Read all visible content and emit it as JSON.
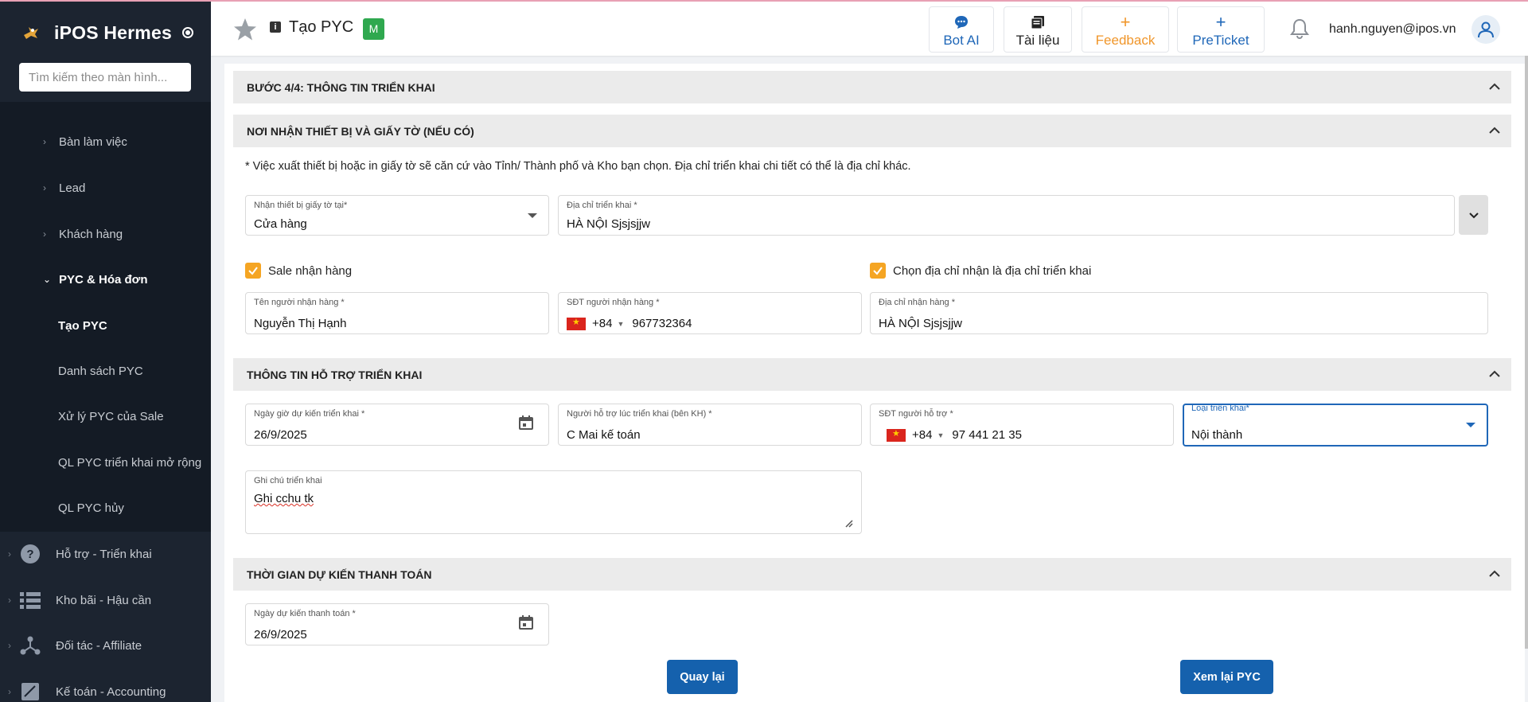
{
  "sidebar": {
    "brand": "iPOS Hermes",
    "search_placeholder": "Tìm kiếm theo màn hình...",
    "sub_items": [
      {
        "label": "Bàn làm việc"
      },
      {
        "label": "Lead"
      },
      {
        "label": "Khách hàng"
      },
      {
        "label": "PYC & Hóa đơn"
      },
      {
        "label": "Tạo PYC"
      },
      {
        "label": "Danh sách PYC"
      },
      {
        "label": "Xử lý PYC của Sale"
      },
      {
        "label": "QL PYC triển khai mở rộng"
      },
      {
        "label": "QL PYC hủy"
      }
    ],
    "main_items": [
      {
        "label": "Hỗ trợ - Triển khai",
        "icon": "help-circle-icon"
      },
      {
        "label": "Kho bãi - Hậu cần",
        "icon": "list-icon"
      },
      {
        "label": "Đối tác - Affiliate",
        "icon": "network-icon"
      },
      {
        "label": "Kế toán - Accounting",
        "icon": "accounting-icon"
      }
    ]
  },
  "header": {
    "title": "Tạo PYC",
    "badge": "M",
    "buttons": [
      {
        "label": "Bot AI",
        "icon": "chat-icon",
        "color": "#1f67b8"
      },
      {
        "label": "Tài liệu",
        "icon": "document-icon",
        "color": "#222222"
      },
      {
        "label": "Feedback",
        "icon": "plus-icon",
        "color": "#f0962a"
      },
      {
        "label": "PreTicket",
        "icon": "plus-icon",
        "color": "#1f67b8"
      }
    ],
    "user_email": "hanh.nguyen@ipos.vn"
  },
  "sections": {
    "step": "BƯỚC 4/4: THÔNG TIN TRIỂN KHAI",
    "receive": "NƠI NHẬN THIẾT BỊ VÀ GIẤY TỜ (NẾU CÓ)",
    "support": "THÔNG TIN HỖ TRỢ TRIỂN KHAI",
    "payment": "THỜI GIAN DỰ KIẾN THANH TOÁN"
  },
  "note": "* Việc xuất thiết bị hoặc in giấy tờ sẽ căn cứ vào Tỉnh/ Thành phố và Kho bạn chọn. Địa chỉ triển khai chi tiết có thể là địa chỉ khác.",
  "form": {
    "receive_at": {
      "label": "Nhận thiết bị giấy tờ tại*",
      "value": "Cửa hàng"
    },
    "deploy_address": {
      "label": "Địa chỉ triển khai *",
      "value": "HÀ NỘI Sjsjsjjw"
    },
    "sale_receive": {
      "label": "Sale nhận hàng",
      "checked": true
    },
    "use_deploy_address": {
      "label": "Chọn địa chỉ nhận là địa chỉ triển khai",
      "checked": true
    },
    "receiver_name": {
      "label": "Tên người nhận hàng *",
      "value": "Nguyễn Thị Hạnh"
    },
    "receiver_phone": {
      "label": "SĐT người nhận hàng *",
      "code": "+84",
      "value": "967732364"
    },
    "receiver_address": {
      "label": "Địa chỉ nhận hàng *",
      "value": "HÀ NỘI Sjsjsjjw"
    },
    "deploy_date": {
      "label": "Ngày giờ dự kiến triển khai *",
      "value": "26/9/2025"
    },
    "support_person": {
      "label": "Người hỗ trợ lúc triển khai (bên KH) *",
      "value": "C Mai kế toán"
    },
    "support_phone": {
      "label": "SĐT người hỗ trợ *",
      "code": "+84",
      "value": "97 441 21 35"
    },
    "deploy_type": {
      "label": "Loại triển khai*",
      "value": "Nội thành"
    },
    "deploy_note": {
      "label": "Ghi chú triển khai",
      "value": "Ghi cchu tk"
    },
    "payment_date": {
      "label": "Ngày dự kiến thanh toán *",
      "value": "26/9/2025"
    }
  },
  "footer": {
    "back": "Quay lại",
    "review": "Xem lại PYC"
  }
}
